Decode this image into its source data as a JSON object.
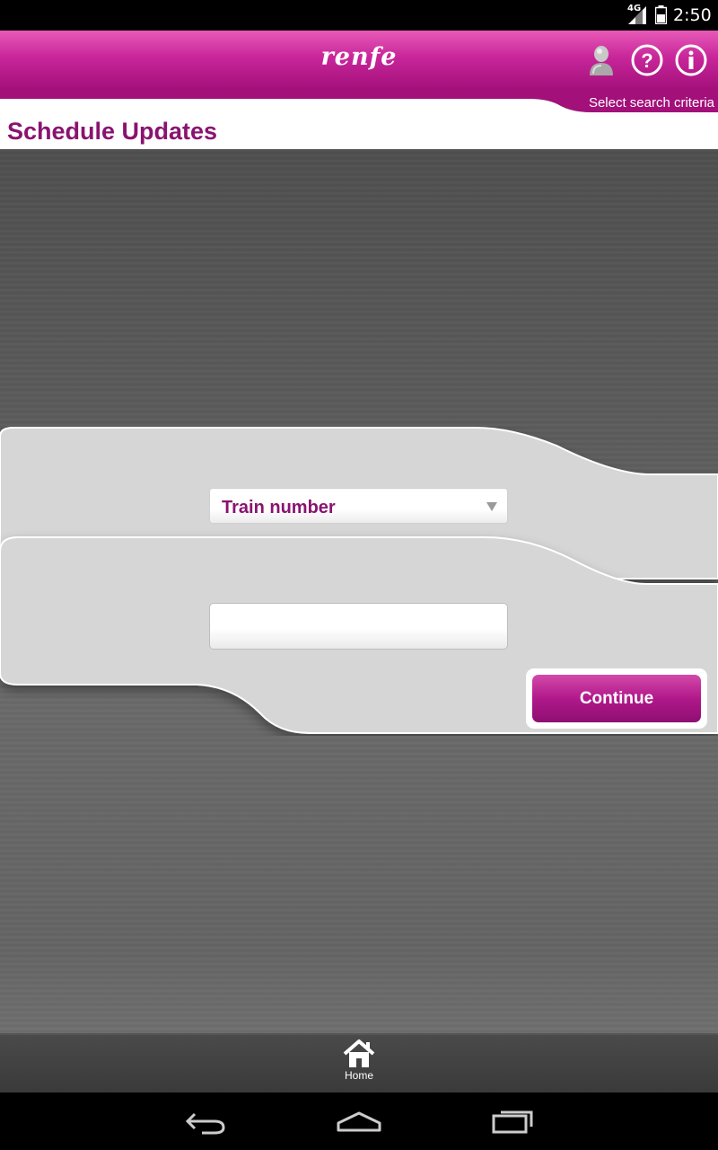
{
  "status_bar": {
    "network": "4G",
    "time": "2:50"
  },
  "header": {
    "logo_text": "renfe",
    "icons": [
      "user-icon",
      "help-icon",
      "info-icon"
    ],
    "subtitle": "Select search criteria"
  },
  "page": {
    "title": "Schedule Updates"
  },
  "form": {
    "criteria_select_value": "Train number",
    "train_number_value": "",
    "continue_label": "Continue"
  },
  "bottom_nav": {
    "home_label": "Home"
  },
  "colors": {
    "brand": "#b1188b",
    "title": "#8a1370",
    "background": "#5b5b5b"
  }
}
